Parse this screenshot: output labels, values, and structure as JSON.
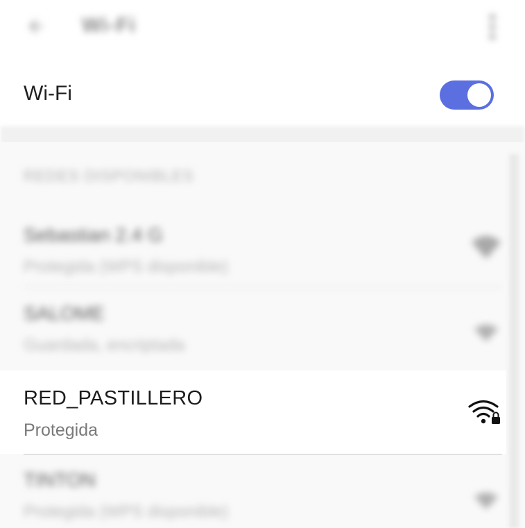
{
  "appbar": {
    "title": "Wi-Fi",
    "back_icon": "arrow-back-icon",
    "more_icon": "more-vert-icon"
  },
  "wifi_toggle": {
    "label": "Wi-Fi",
    "state": "on",
    "accent_color": "#5b6fe0"
  },
  "networks_section": {
    "header": "REDES DISPONIBLES"
  },
  "networks": [
    {
      "name": "Sebastian 2.4 G",
      "status": "Protegida (WPS disponible)",
      "icon": "wifi-lock-icon"
    },
    {
      "name": "SALOME",
      "status": "Guardada, encriptada",
      "icon": "wifi-lock-icon"
    },
    {
      "name": "RED_PASTILLERO",
      "status": "Protegida",
      "icon": "wifi-lock-icon"
    },
    {
      "name": "TINTON",
      "status": "Protegida (WPS disponible)",
      "icon": "wifi-lock-icon"
    }
  ]
}
